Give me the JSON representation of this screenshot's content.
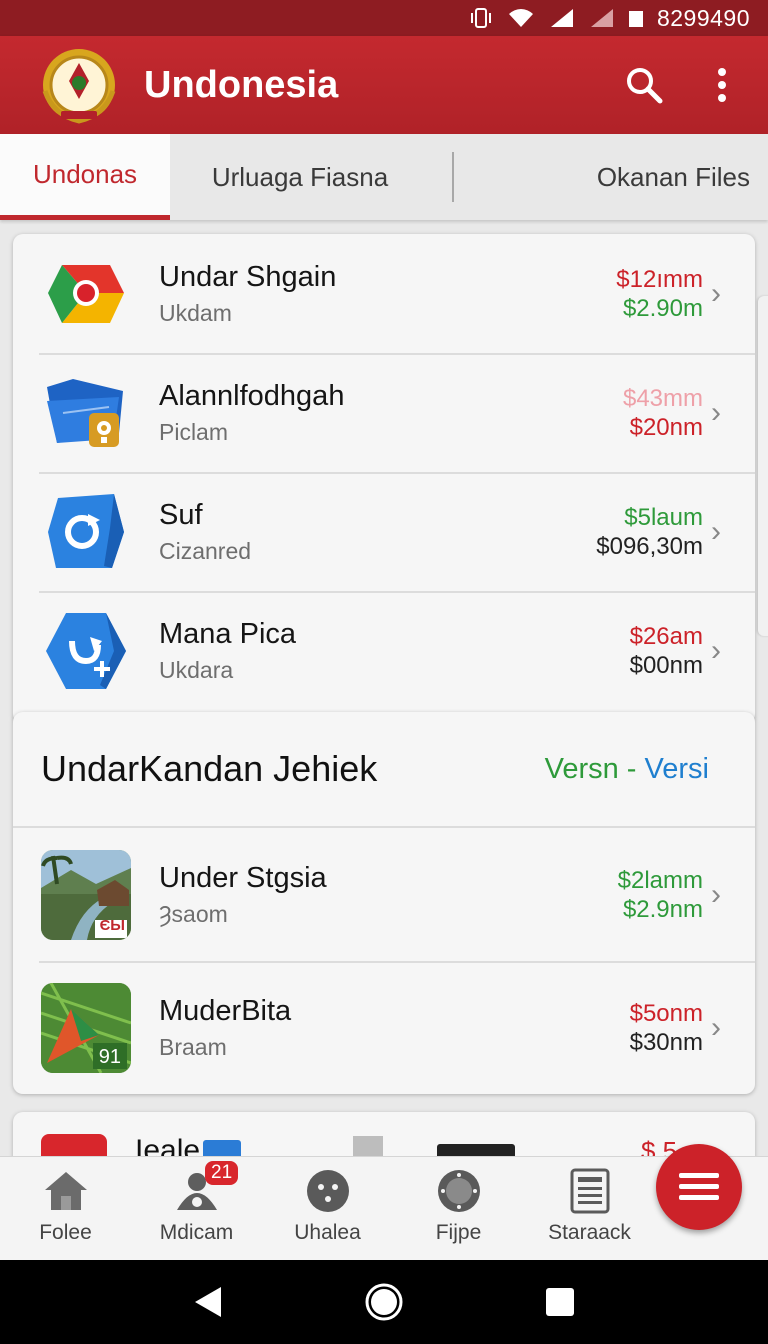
{
  "status_bar": {
    "time": "8299490"
  },
  "app_bar": {
    "title": "Undonesia"
  },
  "tabs": [
    {
      "label": "Undonas"
    },
    {
      "label": "Urluaga Fiasna"
    },
    {
      "label": "Okanan Files"
    }
  ],
  "list1": [
    {
      "title": "Undar Shgain",
      "subtitle": "Ukdam",
      "value1": "$12ımm",
      "value2": "$2.90m",
      "icon": "chrome-like-icon"
    },
    {
      "title": "Alannlfodhgah",
      "subtitle": "Piclam",
      "value1": "$43mm",
      "value2": "$20nm",
      "icon": "folder-settings-icon"
    },
    {
      "title": "Suf",
      "subtitle": "Cizanred",
      "value1": "$5laum",
      "value2": "$096,30m",
      "icon": "refresh-cube-icon"
    },
    {
      "title": "Mana Pica",
      "subtitle": "Ukdara",
      "value1": "$26am",
      "value2": "$00nm",
      "icon": "add-cube-icon"
    }
  ],
  "section": {
    "title": "UndarKandan Jehiek",
    "link_green": "Versn -",
    "link_blue": "Versi"
  },
  "list2": [
    {
      "title": "Under Stgsia",
      "subtitle": "Ȝsaom",
      "value1": "$2lamm",
      "value2": "$2.9nm",
      "icon": "village-photo-icon",
      "thumb_label": "ЄЫ"
    },
    {
      "title": "MuderBita",
      "subtitle": "Braam",
      "value1": "$5onm",
      "value2": "$30nm",
      "icon": "palm-leaf-photo-icon",
      "thumb_label": "91"
    }
  ],
  "peek_row": {
    "title": "Ieale",
    "value": "$.5"
  },
  "bottom_nav": [
    {
      "label": "Folee",
      "icon": "home-icon"
    },
    {
      "label": "Mdicam",
      "icon": "people-icon",
      "badge": "21"
    },
    {
      "label": "Uhalea",
      "icon": "face-icon"
    },
    {
      "label": "Fijpe",
      "icon": "circle-dots-icon"
    },
    {
      "label": "Staraack",
      "icon": "document-icon"
    }
  ],
  "colors": {
    "brand": "#c4292f",
    "status_bar": "#8e1c22",
    "value_red": "#cc2229",
    "value_green": "#2e9a3a",
    "link_blue": "#1f7fcf"
  }
}
